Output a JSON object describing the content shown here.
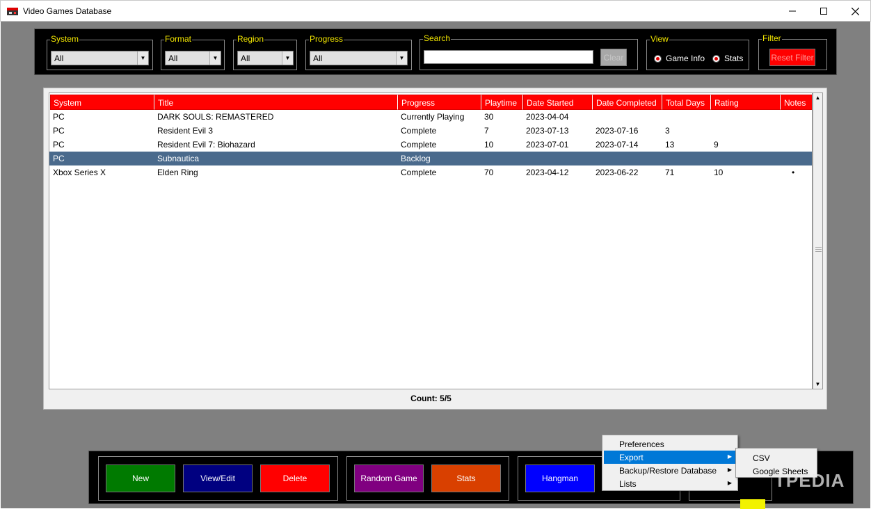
{
  "window": {
    "title": "Video Games Database"
  },
  "filters": {
    "system": {
      "label": "System",
      "value": "All"
    },
    "format": {
      "label": "Format",
      "value": "All"
    },
    "region": {
      "label": "Region",
      "value": "All"
    },
    "progress": {
      "label": "Progress",
      "value": "All"
    },
    "search": {
      "label": "Search",
      "value": "",
      "clear_label": "Clear"
    },
    "view": {
      "label": "View",
      "option1": "Game Info",
      "option2": "Stats"
    },
    "filter": {
      "label": "Filter",
      "reset_label": "Reset Filter"
    }
  },
  "table": {
    "columns": [
      "System",
      "Title",
      "Progress",
      "Playtime",
      "Date Started",
      "Date Completed",
      "Total Days",
      "Rating",
      "Notes"
    ],
    "rows": [
      [
        "PC",
        "DARK SOULS: REMASTERED",
        "Currently Playing",
        "30",
        "2023-04-04",
        "",
        "",
        "",
        ""
      ],
      [
        "PC",
        "Resident Evil 3",
        "Complete",
        "7",
        "2023-07-13",
        "2023-07-16",
        "3",
        "",
        ""
      ],
      [
        "PC",
        "Resident Evil 7: Biohazard",
        "Complete",
        "10",
        "2023-07-01",
        "2023-07-14",
        "13",
        "9",
        ""
      ],
      [
        "PC",
        "Subnautica",
        "Backlog",
        "",
        "",
        "",
        "",
        "",
        ""
      ],
      [
        "Xbox Series X",
        "Elden Ring",
        "Complete",
        "70",
        "2023-04-12",
        "2023-06-22",
        "71",
        "10",
        "•"
      ]
    ],
    "selected_row": 3,
    "count": "Count: 5/5"
  },
  "buttons": {
    "new": "New",
    "view_edit": "View/Edit",
    "delete": "Delete",
    "random_game": "Random Game",
    "stats": "Stats",
    "hangman": "Hangman"
  },
  "menu": {
    "items": [
      "Preferences",
      "Export",
      "Backup/Restore Database",
      "Lists"
    ],
    "highlighted": "Export",
    "export_submenu": [
      "CSV",
      "Google Sheets"
    ]
  },
  "watermark": "TPEDIA",
  "colors": {
    "header_red": "#ff0000",
    "label_yellow": "#f2e600",
    "selection": "#4a6a8c",
    "new_button": "#007a00",
    "view_edit_button": "#000080",
    "delete_button": "#ff0000",
    "random_button": "#800080",
    "stats_button": "#d94000",
    "hangman_button": "#0000ff",
    "menu_highlight": "#0078d7"
  }
}
